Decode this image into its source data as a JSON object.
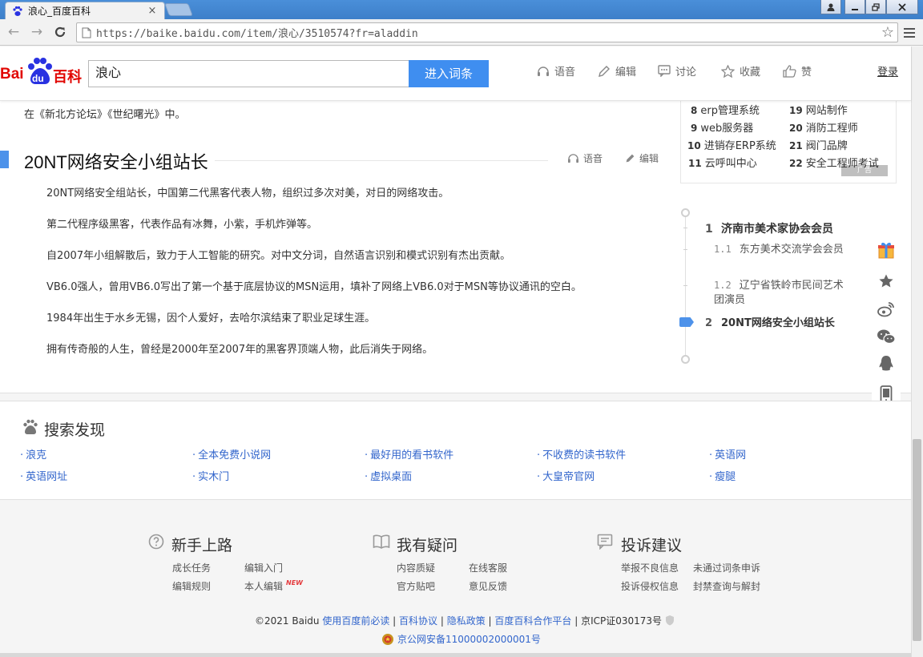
{
  "browser": {
    "tab_title": "浪心_百度百科",
    "tab_close": "×",
    "url": "https://baike.baidu.com/item/浪心/3510574?fr=aladdin",
    "nav_back": "←",
    "nav_forward": "→",
    "nav_reload": "C",
    "bookmark_star": "☆"
  },
  "header": {
    "logo_bai": "Bai",
    "logo_du": "du",
    "logo_baike": "百科",
    "search_value": "浪心",
    "search_button": "进入词条",
    "actions": [
      "语音",
      "编辑",
      "讨论",
      "收藏",
      "赞"
    ],
    "login": "登录"
  },
  "article": {
    "intro_tail": "在《新北方论坛》《世纪曙光》中。",
    "section_title": "20NT网络安全小组站长",
    "section_voice": "语音",
    "section_edit": "编辑",
    "paragraphs": [
      "20NT网络安全组站长，中国第二代黑客代表人物，组织过多次对美，对日的网络攻击。",
      "第二代程序级黑客，代表作品有冰舞，小紫，手机炸弹等。",
      "自2007年小组解散后，致力于人工智能的研究。对中文分词，自然语言识别和模式识别有杰出贡献。",
      "VB6.0强人，曾用VB6.0写出了第一个基于底层协议的MSN运用，填补了网络上VB6.0对于MSN等协议通讯的空白。",
      "1984年出生于水乡无锡，因个人爱好，去哈尔滨结束了职业足球生涯。",
      "拥有传奇般的人生，曾经是2000年至2007年的黑客界顶端人物，此后消失于网络。"
    ]
  },
  "related": [
    {
      "num": "8",
      "label": "erp管理系统"
    },
    {
      "num": "19",
      "label": "网站制作"
    },
    {
      "num": "9",
      "label": "web服务器"
    },
    {
      "num": "20",
      "label": "消防工程师"
    },
    {
      "num": "10",
      "label": "进销存ERP系统"
    },
    {
      "num": "21",
      "label": "阀门品牌"
    },
    {
      "num": "11",
      "label": "云呼叫中心"
    },
    {
      "num": "22",
      "label": "安全工程师考试"
    }
  ],
  "ad_mark": "广告",
  "toc": {
    "l1_1_num": "1",
    "l1_1_label": "济南市美术家协会会员",
    "l2_1_num": "1.1",
    "l2_1_label": "东方美术交流学会会员",
    "l2_2_num": "1.2",
    "l2_2_label": "辽宁省铁岭市民间艺术团演员",
    "l1_2_num": "2",
    "l1_2_label": "20NT网络安全小组站长"
  },
  "discover": {
    "title": "搜索发现",
    "links": [
      "浪克",
      "全本免费小说网",
      "最好用的看书软件",
      "不收费的读书软件",
      "英语网",
      "英语网址",
      "实木门",
      "虚拟桌面",
      "大皇帝官网",
      "瘦腿"
    ]
  },
  "footer": {
    "col1_title": "新手上路",
    "col1_links": [
      "成长任务",
      "编辑入门",
      "编辑规则",
      "本人编辑"
    ],
    "new_badge": "NEW",
    "col2_title": "我有疑问",
    "col2_links": [
      "内容质疑",
      "在线客服",
      "官方贴吧",
      "意见反馈"
    ],
    "col3_title": "投诉建议",
    "col3_links": [
      "举报不良信息",
      "未通过词条申诉",
      "投诉侵权信息",
      "封禁查询与解封"
    ],
    "copyright_prefix": "©2021 Baidu",
    "copyright_links": [
      "使用百度前必读",
      "百科协议",
      "隐私政策",
      "百度百科合作平台"
    ],
    "icp": "京ICP证030173号",
    "beian": "京公网安备11000002000001号"
  },
  "colors": {
    "accent_blue": "#3f8ef0",
    "link_blue": "#3366cc",
    "baidu_red": "#e10602",
    "baidu_blue": "#2932e1"
  }
}
